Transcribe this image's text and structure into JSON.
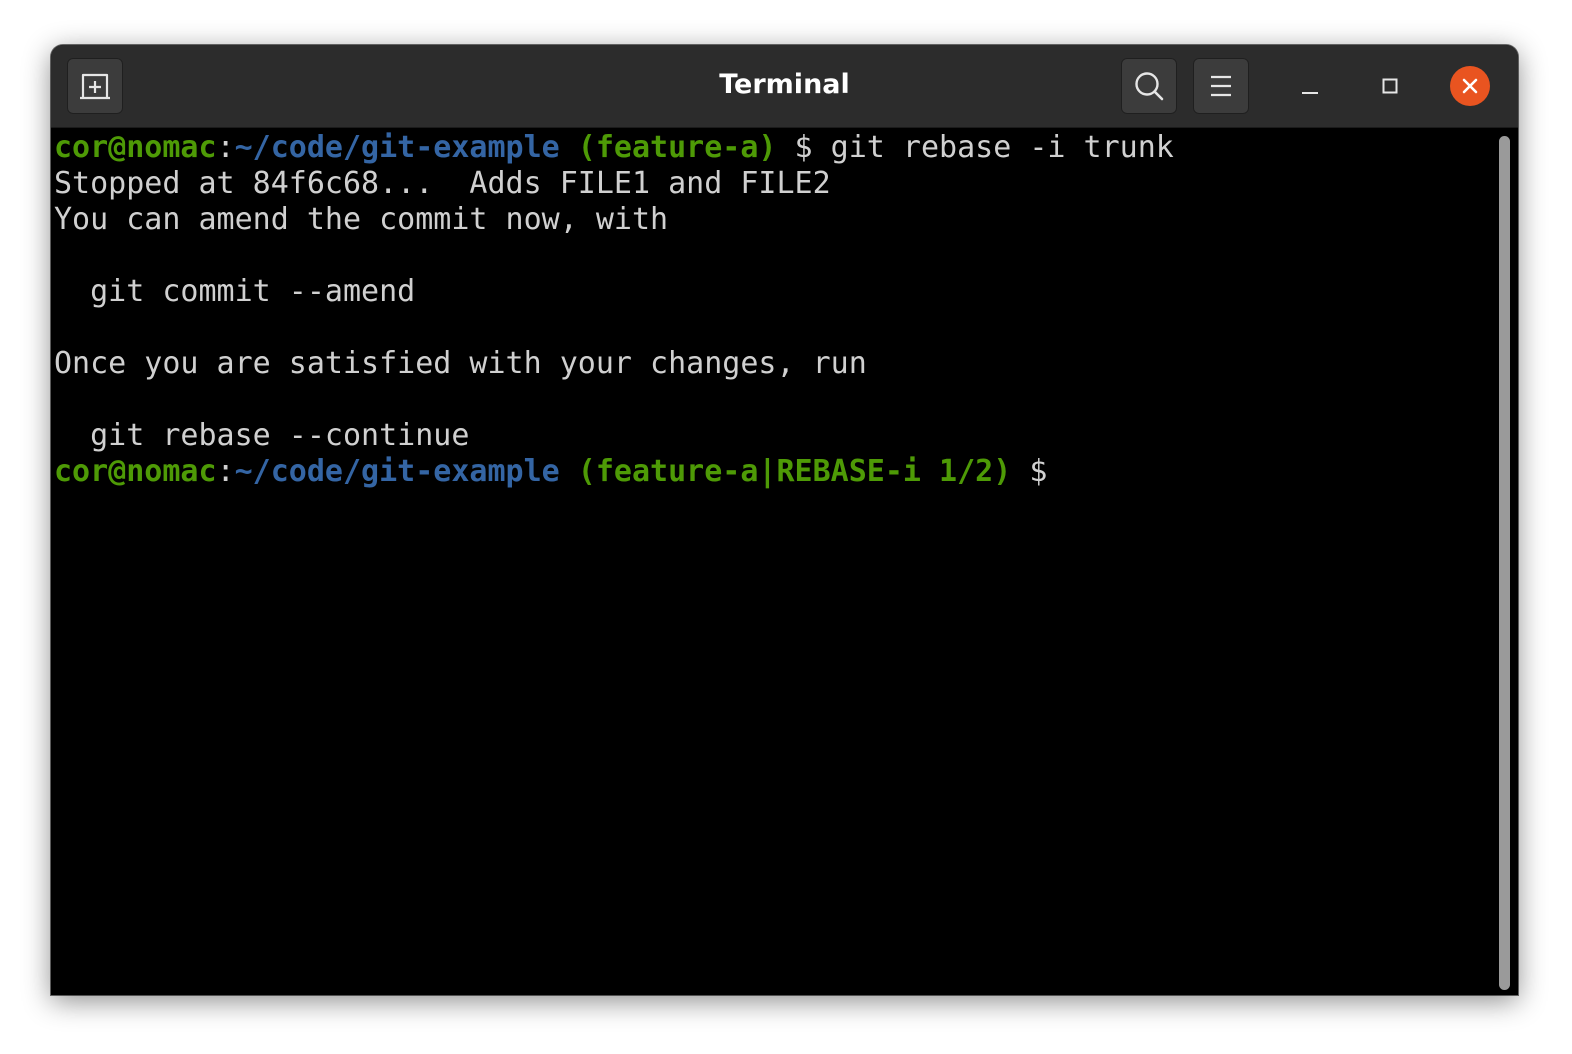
{
  "window": {
    "title": "Terminal"
  },
  "header": {
    "new_tab_icon": "new-tab-icon",
    "search_icon": "search-icon",
    "menu_icon": "hamburger-menu-icon",
    "minimize_icon": "minimize-icon",
    "maximize_icon": "maximize-icon",
    "close_icon": "close-icon",
    "close_color": "#e95420"
  },
  "terminal": {
    "colors": {
      "background": "#000000",
      "foreground": "#d0d0d0",
      "prompt_user": "#4e9a06",
      "prompt_path": "#3465a4"
    },
    "lines": [
      {
        "user": "cor@nomac",
        "sep": ":",
        "path": "~/code/git-example",
        "branch": " (feature-a)",
        "cmd": " $ git rebase -i trunk"
      },
      {
        "text": "Stopped at 84f6c68...  Adds FILE1 and FILE2"
      },
      {
        "text": "You can amend the commit now, with"
      },
      {
        "text": ""
      },
      {
        "text": "  git commit --amend"
      },
      {
        "text": ""
      },
      {
        "text": "Once you are satisfied with your changes, run"
      },
      {
        "text": ""
      },
      {
        "text": "  git rebase --continue"
      },
      {
        "user": "cor@nomac",
        "sep": ":",
        "path": "~/code/git-example",
        "branch": " (feature-a|REBASE-i 1/2)",
        "cmd": " $"
      }
    ]
  }
}
